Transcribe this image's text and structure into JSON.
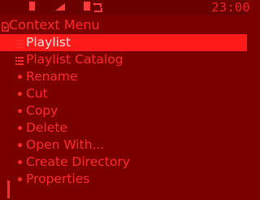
{
  "status": {
    "time": "23:00",
    "icons": [
      "record-icon",
      "signal-icon",
      "battery-icon",
      "repeat-icon"
    ]
  },
  "title": {
    "text": "Context Menu",
    "icon": "context-menu-icon"
  },
  "menu": {
    "items": [
      {
        "label": "Playlist",
        "icon": "list-icon",
        "selected": true
      },
      {
        "label": "Playlist Catalog",
        "icon": "list-icon",
        "selected": false
      },
      {
        "label": "Rename",
        "icon": "bullet-icon",
        "selected": false
      },
      {
        "label": "Cut",
        "icon": "bullet-icon",
        "selected": false
      },
      {
        "label": "Copy",
        "icon": "bullet-icon",
        "selected": false
      },
      {
        "label": "Delete",
        "icon": "bullet-icon",
        "selected": false
      },
      {
        "label": "Open With...",
        "icon": "bullet-icon",
        "selected": false
      },
      {
        "label": "Create Directory",
        "icon": "bullet-icon",
        "selected": false
      },
      {
        "label": "Properties",
        "icon": "bullet-icon",
        "selected": false
      }
    ]
  },
  "colors": {
    "background": "#7a0000",
    "foreground": "#ff2a2a",
    "selection": "#ff1a1a"
  }
}
